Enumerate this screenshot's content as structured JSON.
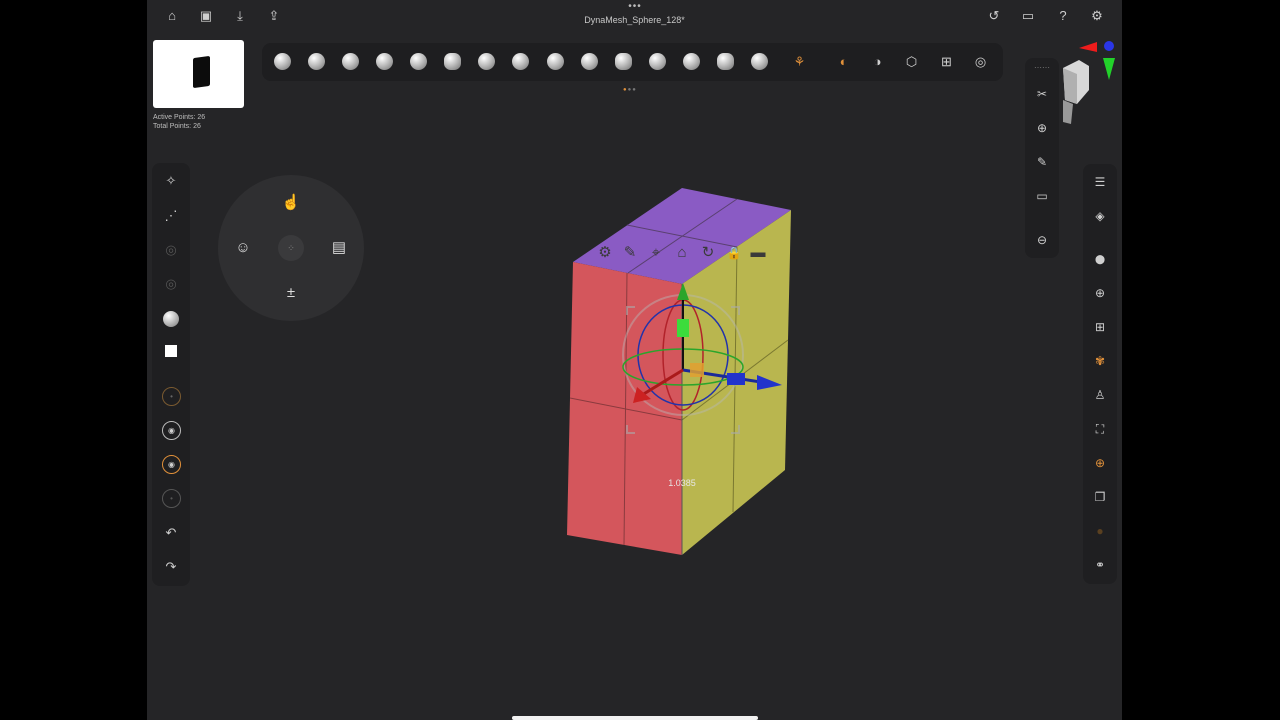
{
  "header": {
    "title": "DynaMesh_Sphere_128*",
    "grip": "•••",
    "left_icons": [
      {
        "name": "home-icon",
        "glyph": "⌂"
      },
      {
        "name": "save-icon",
        "glyph": "▣"
      },
      {
        "name": "import-icon",
        "glyph": "⤓"
      },
      {
        "name": "share-icon",
        "glyph": "⇪"
      }
    ],
    "right_icons": [
      {
        "name": "history-icon",
        "glyph": "↺"
      },
      {
        "name": "layout-icon",
        "glyph": "▭"
      },
      {
        "name": "help-icon",
        "glyph": "?"
      },
      {
        "name": "settings-gear-icon",
        "glyph": "⚙"
      }
    ]
  },
  "stats": {
    "active_points": "Active Points: 26",
    "total_points": "Total Points: 26"
  },
  "brushbar": {
    "tools": [
      {
        "name": "pointer-icon",
        "glyph": "⚘"
      },
      {
        "name": "material-icon",
        "glyph": "◐"
      },
      {
        "name": "half-shade-icon",
        "glyph": "◑"
      },
      {
        "name": "cube-wire-icon",
        "glyph": "⬡"
      },
      {
        "name": "add-square-icon",
        "glyph": "⊞"
      },
      {
        "name": "toggle-icon",
        "glyph": "◎"
      }
    ]
  },
  "viewport": {
    "value_label": "1.0385",
    "gizmo_tools": [
      {
        "name": "gizmo-settings-icon",
        "glyph": "⚙"
      },
      {
        "name": "gizmo-pin-icon",
        "glyph": "✎"
      },
      {
        "name": "gizmo-location-icon",
        "glyph": "⌖"
      },
      {
        "name": "gizmo-home-icon",
        "glyph": "⌂"
      },
      {
        "name": "gizmo-reset-icon",
        "glyph": "↻"
      },
      {
        "name": "gizmo-lock-icon",
        "glyph": "🔒"
      },
      {
        "name": "gizmo-minus-icon",
        "glyph": "▬"
      }
    ]
  },
  "colors": {
    "panel_bg": "#252527",
    "toolbar_bg": "#1e1e20",
    "accent": "#e0903a",
    "cube_top": "#8a5bc4",
    "cube_left": "#d4565c",
    "cube_right": "#b9b64f"
  }
}
